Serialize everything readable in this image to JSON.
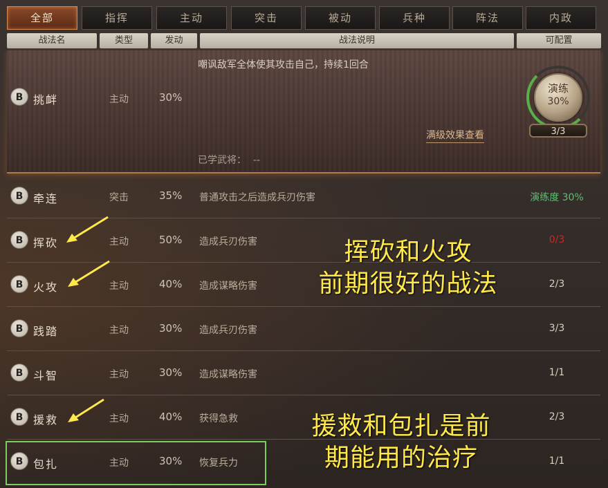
{
  "tabs": [
    "全部",
    "指挥",
    "主动",
    "突击",
    "被动",
    "兵种",
    "阵法",
    "内政"
  ],
  "active_tab": "全部",
  "headers": {
    "name": "战法名",
    "type": "类型",
    "trigger": "发动",
    "desc": "战法说明",
    "configurable": "可配置"
  },
  "expanded": {
    "grade": "B",
    "name": "挑衅",
    "type": "主动",
    "rate": "30%",
    "desc": "嘲讽敌军全体使其攻击自己，持续1回合",
    "full_effect": "满级效果查看",
    "learned_label": "已学武将：",
    "learned_value": "--",
    "practice": {
      "label": "演练",
      "percent": "30%",
      "count": "3/3",
      "progress": 0.3
    }
  },
  "rows": [
    {
      "grade": "B",
      "name": "牵连",
      "type": "突击",
      "rate": "35%",
      "desc": "普通攻击之后造成兵刃伤害",
      "conf": "演练度 30%",
      "conf_color": "#5fbf74"
    },
    {
      "grade": "B",
      "name": "挥砍",
      "type": "主动",
      "rate": "50%",
      "desc": "造成兵刃伤害",
      "conf": "0/3",
      "conf_color": "#c82a22"
    },
    {
      "grade": "B",
      "name": "火攻",
      "type": "主动",
      "rate": "40%",
      "desc": "造成谋略伤害",
      "conf": "2/3",
      "conf_color": "#d8d0c2"
    },
    {
      "grade": "B",
      "name": "践踏",
      "type": "主动",
      "rate": "30%",
      "desc": "造成兵刃伤害",
      "conf": "3/3",
      "conf_color": "#d8d0c2"
    },
    {
      "grade": "B",
      "name": "斗智",
      "type": "主动",
      "rate": "30%",
      "desc": "造成谋略伤害",
      "conf": "1/1",
      "conf_color": "#d8d0c2"
    },
    {
      "grade": "B",
      "name": "援救",
      "type": "主动",
      "rate": "40%",
      "desc": "获得急救",
      "conf": "2/3",
      "conf_color": "#d8d0c2"
    },
    {
      "grade": "B",
      "name": "包扎",
      "type": "主动",
      "rate": "30%",
      "desc": "恢复兵力",
      "conf": "1/1",
      "conf_color": "#d8d0c2"
    }
  ],
  "annotations": {
    "note1": [
      "挥砍和火攻",
      "前期很好的战法"
    ],
    "note2": [
      "援救和包扎是前",
      "期能用的治疗"
    ],
    "highlight_color": "#ffe94a",
    "box_color": "#7ccf5f"
  }
}
